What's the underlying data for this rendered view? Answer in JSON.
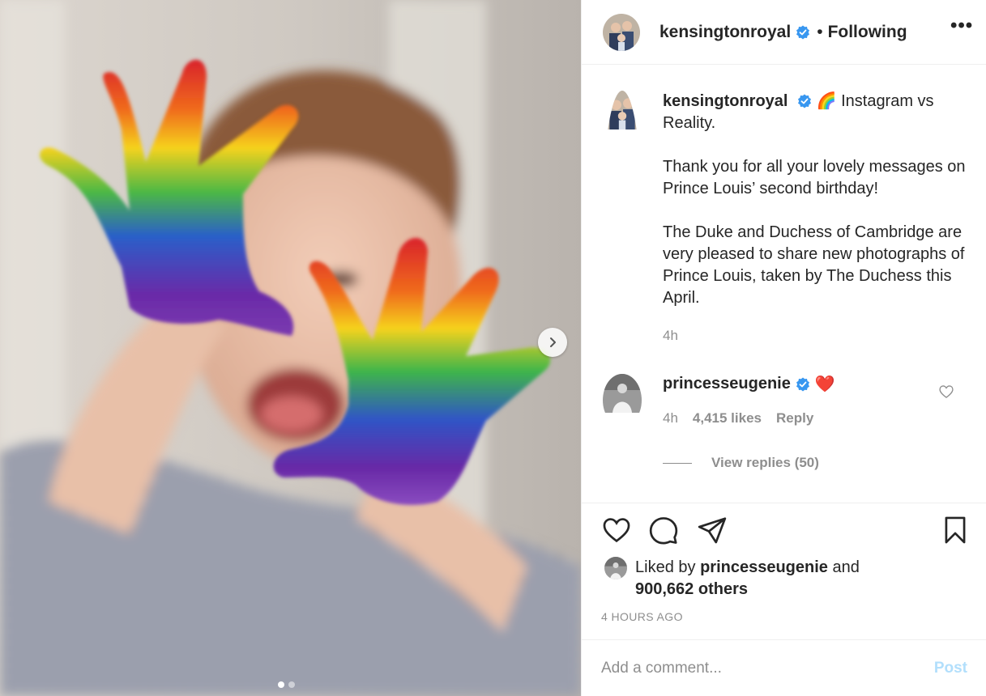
{
  "header": {
    "username": "kensingtonroyal",
    "separator": "•",
    "follow_status": "Following",
    "more_label": "•••"
  },
  "caption": {
    "username": "kensingtonroyal",
    "emoji": "🌈",
    "line1": "Instagram vs Reality.",
    "para2": "Thank you for all your lovely messages on Prince Louis’ second birthday!",
    "para3": "The Duke and Duchess of Cambridge are very pleased to share new photographs of Prince Louis, taken by The Duchess this April.",
    "time": "4h"
  },
  "comment": {
    "username": "princesseugenie",
    "emoji": "❤️",
    "time": "4h",
    "likes": "4,415 likes",
    "reply_label": "Reply",
    "view_replies": "View replies (50)"
  },
  "likes": {
    "prefix": "Liked by",
    "user": "princesseugenie",
    "conj": "and",
    "others": "900,662 others"
  },
  "timestamp": "4 HOURS AGO",
  "add_comment": {
    "placeholder": "Add a comment...",
    "post_label": "Post"
  },
  "carousel": {
    "total": 2,
    "current": 1
  },
  "colors": {
    "verified": "#3897f0",
    "post_disabled": "#b2dffc",
    "secondary_text": "#8e8e8e",
    "primary_text": "#262626"
  },
  "icons": {
    "like": "heart-icon",
    "comment": "comment-bubble-icon",
    "share": "paper-plane-icon",
    "save": "bookmark-icon",
    "next": "chevron-right-icon",
    "verified": "verified-badge-icon"
  }
}
